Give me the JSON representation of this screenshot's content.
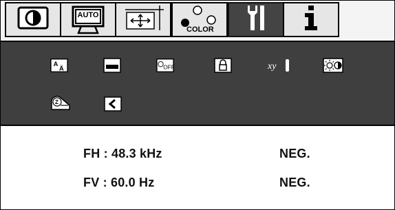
{
  "tabs": [
    {
      "name": "contrast-tab",
      "icon": "contrast-icon"
    },
    {
      "name": "auto-tab",
      "icon": "auto-monitor-icon",
      "label": "AUTO"
    },
    {
      "name": "size-position-tab",
      "icon": "size-position-icon"
    },
    {
      "name": "color-tab",
      "icon": "color-dots-icon",
      "label": "COLOR"
    },
    {
      "name": "tools-tab",
      "icon": "tools-icon",
      "active": true
    },
    {
      "name": "information-tab",
      "icon": "information-icon",
      "label": "i"
    }
  ],
  "tools": {
    "sub_icons": [
      "language-icon",
      "osd-position-icon",
      "osd-off-timer-icon",
      "lock-icon",
      "xy-indicator-icon",
      "brightness-contrast-icon",
      "sleep-icon",
      "reset-icon"
    ],
    "osd_off_label": "OFF",
    "language_label_a": "A",
    "language_label_b": "Ä",
    "xy_label": "xy",
    "sleep_label": "Z"
  },
  "info": {
    "fh_label": "FH : 48.3 kHz",
    "fh_polarity": "NEG.",
    "fv_label": "FV : 60.0 Hz",
    "fv_polarity": "NEG."
  },
  "colors": {
    "panel_bg": "#3f3f3f",
    "tab_bg": "#e6e6e6",
    "tab_active_bg": "#444444"
  }
}
